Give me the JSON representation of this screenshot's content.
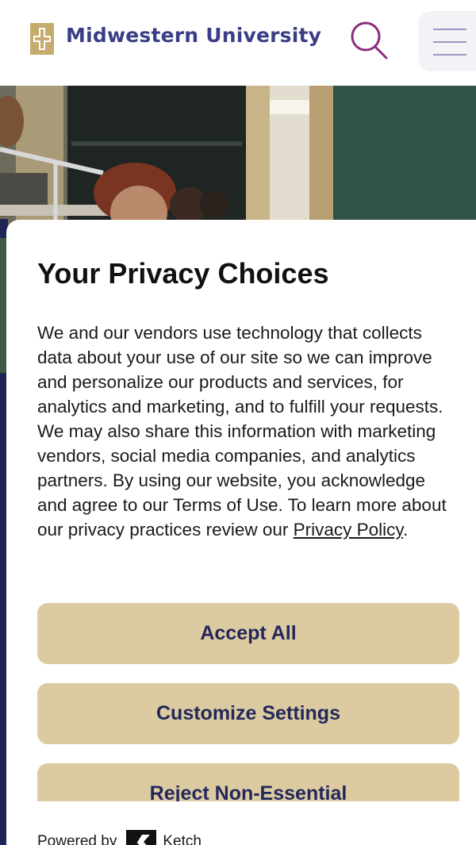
{
  "header": {
    "brand": "Midwestern University",
    "colors": {
      "brand": "#3b3e86",
      "gold": "#c6ab6e",
      "search": "#8a2d7e"
    }
  },
  "privacy": {
    "title": "Your Privacy Choices",
    "body_before_link": "We and our vendors use technology that collects data about your use of our site so we can improve and personalize our products and services, for analytics and marketing, and to fulfill your requests. We may also share this information with marketing vendors, social media companies, and analytics partners. By using our website, you acknowledge and agree to our Terms of Use. To learn more about our privacy practices review our ",
    "link_text": "Privacy Policy",
    "body_after_link": ".",
    "buttons": {
      "accept": "Accept All",
      "customize": "Customize Settings",
      "reject": "Reject Non-Essential"
    },
    "powered_by": "Powered by",
    "ketch": "Ketch"
  }
}
